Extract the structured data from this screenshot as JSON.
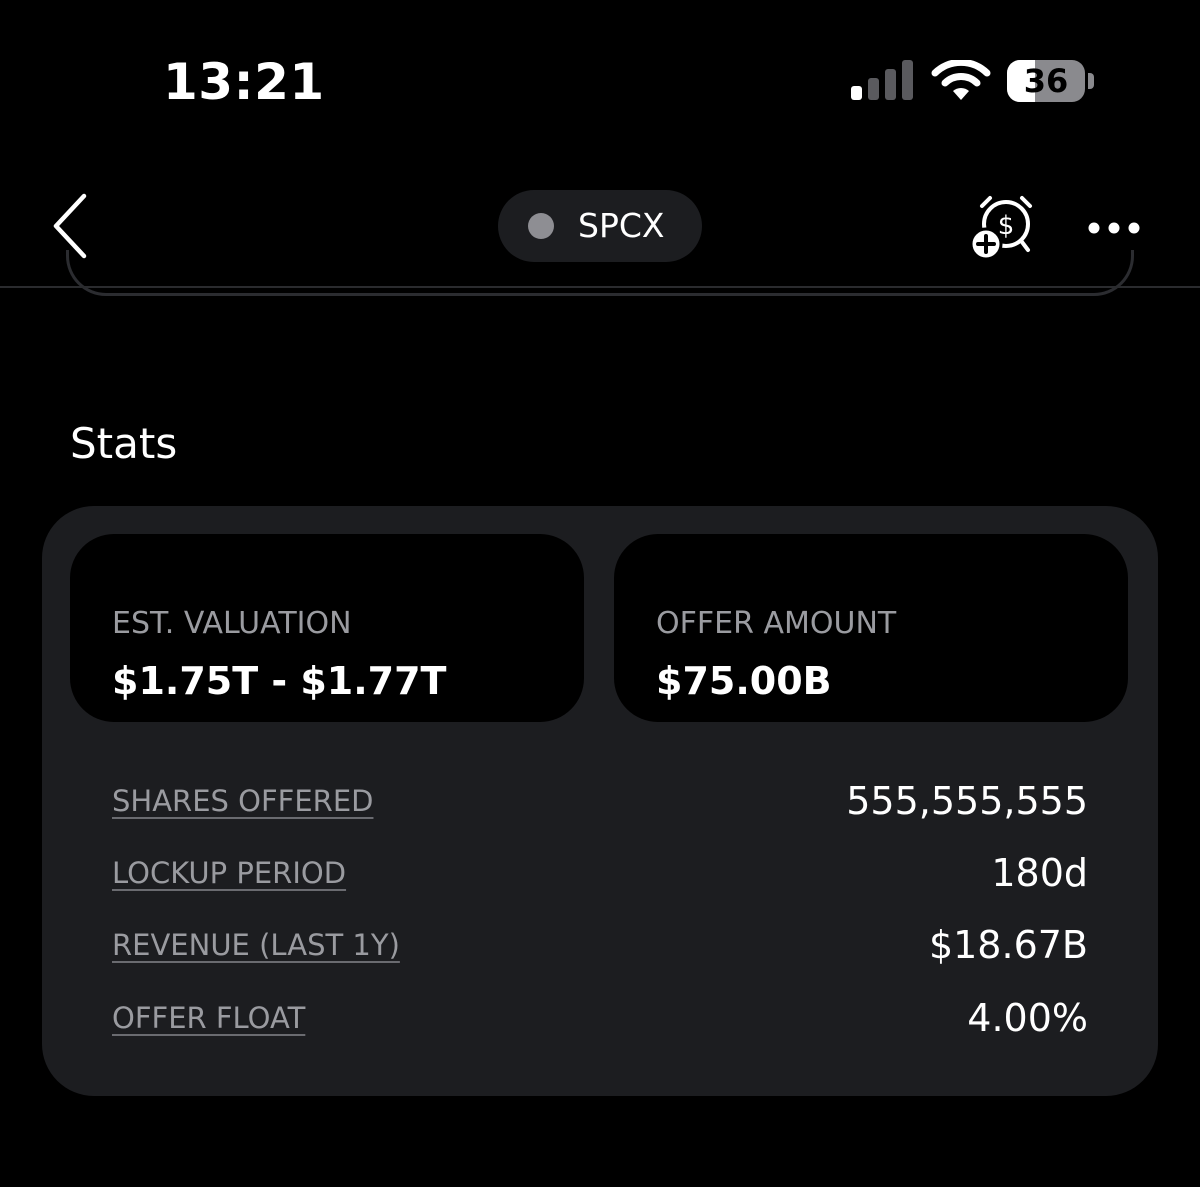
{
  "status_bar": {
    "time": "13:21",
    "battery_level": "36",
    "battery_fraction": 0.36
  },
  "nav": {
    "ticker": "SPCX"
  },
  "stats": {
    "title": "Stats",
    "tiles": [
      {
        "label": "EST. VALUATION",
        "value": "$1.75T - $1.77T"
      },
      {
        "label": "OFFER AMOUNT",
        "value": "$75.00B"
      }
    ],
    "rows": [
      {
        "label": "SHARES OFFERED",
        "value": "555,555,555"
      },
      {
        "label": "LOCKUP PERIOD",
        "value": "180d"
      },
      {
        "label": "REVENUE (LAST 1Y)",
        "value": "$18.67B"
      },
      {
        "label": "OFFER FLOAT",
        "value": "4.00%"
      }
    ]
  },
  "colors": {
    "background": "#000000",
    "card": "#1c1d20",
    "muted_text": "#9a9ba0",
    "text": "#ffffff"
  },
  "icons": [
    "back-chevron-icon",
    "price-alert-icon",
    "more-icon",
    "signal-icon",
    "wifi-icon",
    "battery-icon"
  ]
}
